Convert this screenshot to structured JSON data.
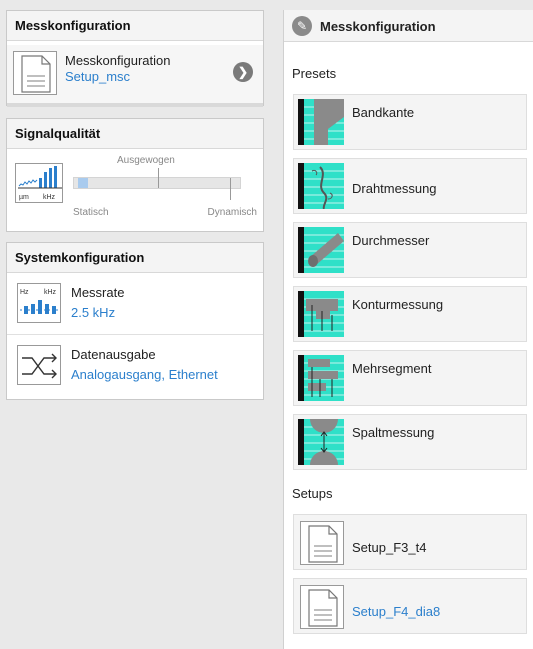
{
  "left": {
    "messkonfiguration": {
      "header": "Messkonfiguration",
      "title": "Messkonfiguration",
      "value": "Setup_msc",
      "icon": "document-icon",
      "action_icon": "chevron-right-icon"
    },
    "signalqualitaet": {
      "header": "Signalqualität",
      "slider_center_label": "Ausgewogen",
      "slider_left_label": "Statisch",
      "slider_right_label": "Dynamisch",
      "icon_unit_left": "µm",
      "icon_unit_right": "kHz",
      "slider_position": "Statisch"
    },
    "systemkonfiguration": {
      "header": "Systemkonfiguration",
      "items": [
        {
          "title": "Messrate",
          "value": "2.5 kHz",
          "icon": "measure-rate-icon",
          "icon_unit_left": "Hz",
          "icon_unit_right": "kHz"
        },
        {
          "title": "Datenausgabe",
          "value": "Analogausgang, Ethernet",
          "icon": "data-output-icon"
        }
      ]
    }
  },
  "right": {
    "header": "Messkonfiguration",
    "header_icon": "pencil-icon",
    "presets_label": "Presets",
    "presets": [
      {
        "label": "Bandkante",
        "icon": "band-edge-icon"
      },
      {
        "label": "Drahtmessung",
        "icon": "wire-measurement-icon"
      },
      {
        "label": "Durchmesser",
        "icon": "diameter-icon"
      },
      {
        "label": "Konturmessung",
        "icon": "contour-measurement-icon"
      },
      {
        "label": "Mehrsegment",
        "icon": "multi-segment-icon"
      },
      {
        "label": "Spaltmessung",
        "icon": "gap-measurement-icon"
      }
    ],
    "setups_label": "Setups",
    "setups": [
      {
        "label": "Setup_F3_t4",
        "color": "#222222"
      },
      {
        "label": "Setup_F4_dia8",
        "color": "#2b7fcc"
      }
    ]
  },
  "colors": {
    "accent": "#2b7fcc",
    "preset_thumb": "#2fe0c8"
  }
}
